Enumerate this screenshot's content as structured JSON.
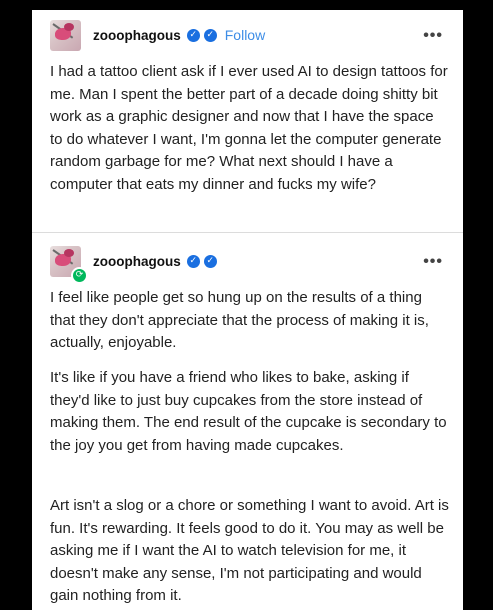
{
  "post1": {
    "username": "zooophagous",
    "follow_label": "Follow",
    "more_label": "•••",
    "text": "I had a tattoo client ask if I ever used AI to design tattoos for me. Man I spent the better part of a decade doing shitty bit work as a graphic designer and now that I have the space to do whatever I want, I'm gonna let the computer generate random garbage for me? What next should I have a computer that eats my dinner and fucks my wife?"
  },
  "post2": {
    "username": "zooophagous",
    "more_label": "•••",
    "paragraphs": [
      "I feel like people get so hung up on the results of a thing that they don't appreciate that the process of making it is, actually, enjoyable.",
      "It's like if you have a friend who likes to bake, asking if they'd like to just buy cupcakes from the store instead of making them. The end result of the cupcake is secondary to the joy you get from having made cupcakes.",
      "Art isn't a slog or a chore or something I want to avoid. Art is fun. It's rewarding. It feels good to do it. You may as well be asking me if I want the AI to watch television for me, it doesn't make any sense, I'm not participating and would gain nothing from it."
    ]
  },
  "icons": {
    "verified": "verified-badge-icon",
    "reblog": "reblog-icon",
    "more": "more-options-icon"
  },
  "colors": {
    "background": "#000000",
    "card": "#ffffff",
    "follow": "#3d8de6",
    "verified": "#1a6fe0",
    "reblog_badge": "#00b85c"
  }
}
